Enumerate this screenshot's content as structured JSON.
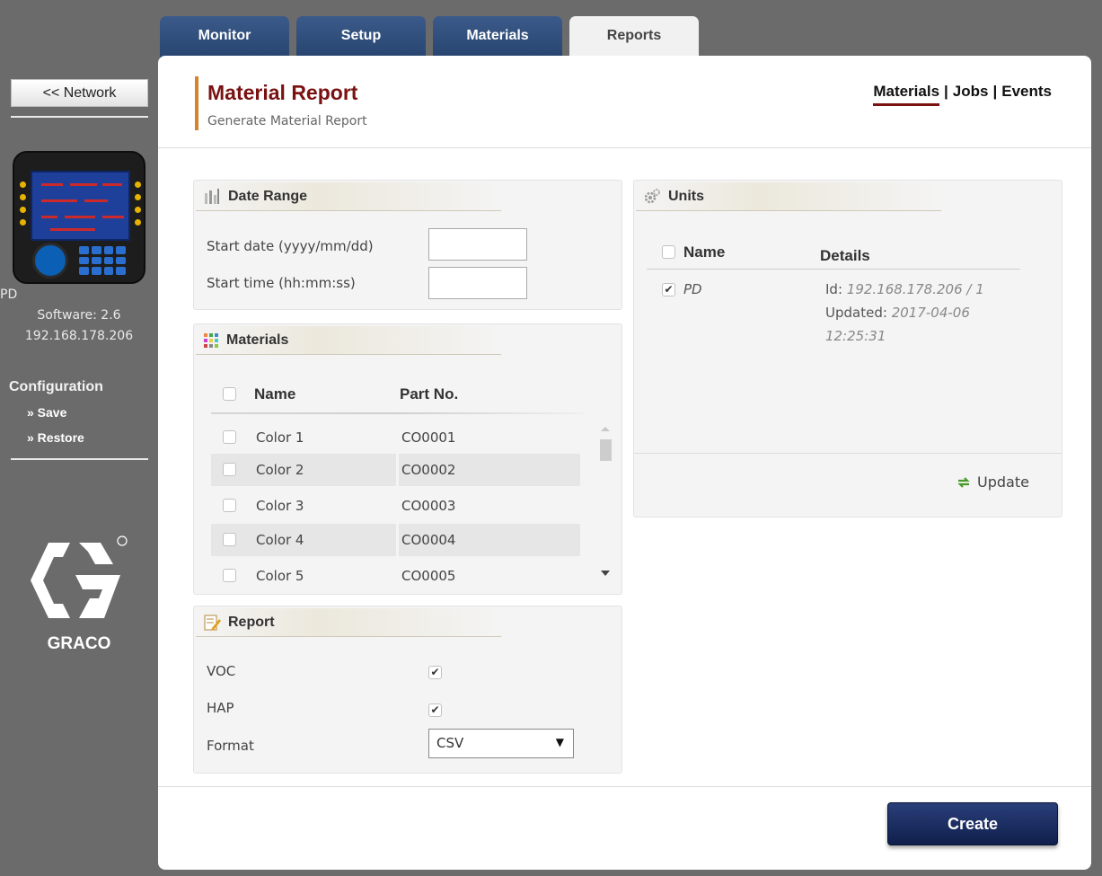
{
  "tabs": [
    {
      "label": "Monitor"
    },
    {
      "label": "Setup"
    },
    {
      "label": "Materials"
    },
    {
      "label": "Reports"
    }
  ],
  "sidebar": {
    "network_button": "<< Network",
    "device_name": "PD",
    "software": "Software: 2.6",
    "ip": "192.168.178.206",
    "config_title": "Configuration",
    "save_link": "» Save",
    "restore_link": "» Restore",
    "logo_text": "GRACO"
  },
  "header": {
    "title": "Material Report",
    "subtitle": "Generate Material Report",
    "nav": {
      "materials": "Materials",
      "sep1": "|",
      "jobs": "Jobs",
      "sep2": "|",
      "events": "Events"
    }
  },
  "date_range": {
    "title": "Date Range",
    "start_date_label": "Start date (yyyy/mm/dd)",
    "start_date_value": "",
    "start_time_label": "Start time (hh:mm:ss)",
    "start_time_value": ""
  },
  "materials": {
    "title": "Materials",
    "col_name": "Name",
    "col_part": "Part No.",
    "rows": [
      {
        "name": "Color 1",
        "part": "CO0001"
      },
      {
        "name": "Color 2",
        "part": "CO0002"
      },
      {
        "name": "Color 3",
        "part": "CO0003"
      },
      {
        "name": "Color 4",
        "part": "CO0004"
      },
      {
        "name": "Color 5",
        "part": "CO0005"
      }
    ]
  },
  "report": {
    "title": "Report",
    "voc_label": "VOC",
    "voc_checked": true,
    "hap_label": "HAP",
    "hap_checked": true,
    "format_label": "Format",
    "format_value": "CSV"
  },
  "units": {
    "title": "Units",
    "col_name": "Name",
    "col_details": "Details",
    "rows": [
      {
        "name": "PD",
        "checked": true,
        "id_label": "Id:",
        "id_value": "192.168.178.206 / 1",
        "updated_label": "Updated:",
        "updated_value_1": "2017-04-06",
        "updated_value_2": "12:25:31"
      }
    ],
    "update_label": "Update"
  },
  "create_button": "Create",
  "colors": {
    "accent_title": "#7a1212",
    "header_bar": "#d6832e",
    "tab_dark": "#2f4e7e",
    "create_button": "#162a5e"
  }
}
